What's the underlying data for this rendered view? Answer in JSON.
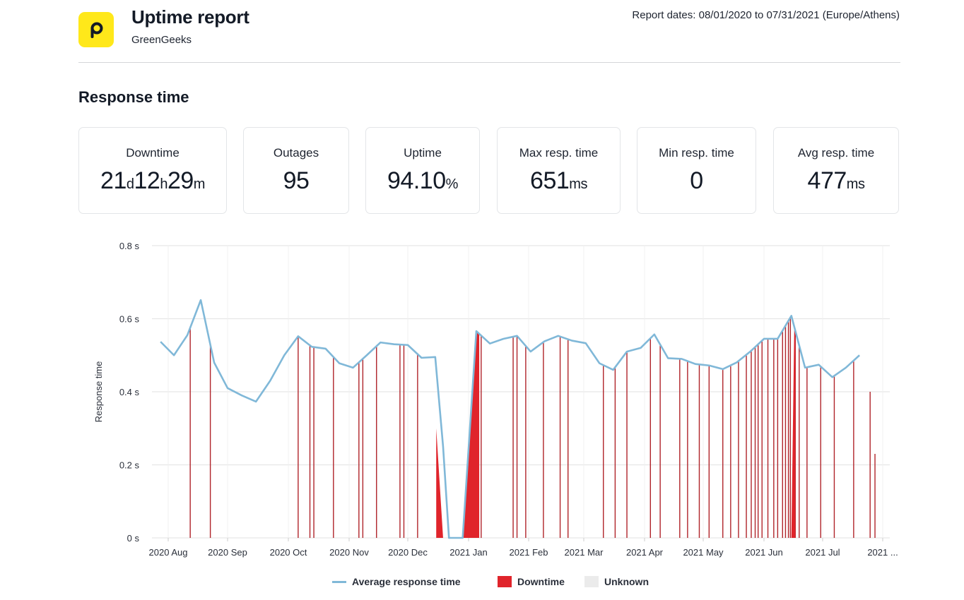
{
  "header": {
    "logo_letter": "p",
    "title": "Uptime report",
    "subtitle": "GreenGeeks",
    "report_dates": "Report dates: 08/01/2020 to 07/31/2021 (Europe/Athens)"
  },
  "section_title": "Response time",
  "stats": [
    {
      "label": "Downtime",
      "value_parts": [
        [
          "21",
          "d"
        ],
        [
          "12",
          "h"
        ],
        [
          "29",
          "m"
        ]
      ]
    },
    {
      "label": "Outages",
      "value_parts": [
        [
          "95",
          ""
        ]
      ]
    },
    {
      "label": "Uptime",
      "value_parts": [
        [
          "94.10",
          "%"
        ]
      ]
    },
    {
      "label": "Max resp. time",
      "value_parts": [
        [
          "651",
          "ms"
        ]
      ]
    },
    {
      "label": "Min resp. time",
      "value_parts": [
        [
          "0",
          ""
        ]
      ]
    },
    {
      "label": "Avg resp. time",
      "value_parts": [
        [
          "477",
          "ms"
        ]
      ]
    }
  ],
  "colors": {
    "accent_logo": "#ffe81a",
    "line": "#80b8d8",
    "downtime": "#e0242b",
    "unknown": "#ebebeb",
    "grid": "#e6e6e6"
  },
  "chart_data": {
    "type": "line",
    "title": "",
    "xlabel": "",
    "ylabel": "Response time",
    "ylim": [
      0,
      0.8
    ],
    "yticks": [
      0,
      0.2,
      0.4,
      0.6,
      0.8
    ],
    "ytick_labels": [
      "0 s",
      "0.2 s",
      "0.4 s",
      "0.6 s",
      "0.8 s"
    ],
    "x_unit": "days since 2020-08-01",
    "xlim": [
      -5,
      371
    ],
    "xticks": [
      0,
      31,
      61,
      92,
      122,
      153,
      184,
      212,
      243,
      273,
      304,
      334,
      365
    ],
    "xtick_labels": [
      "2020 Aug",
      "2020 Sep",
      "2020 Oct",
      "2020 Nov",
      "2020 Dec",
      "2021 Jan",
      "2021 Feb",
      "2021 Mar",
      "2021 Apr",
      "2021 May",
      "2021 Jun",
      "2021 Jul",
      "2021 ..."
    ],
    "grid": true,
    "legend": {
      "position": "bottom-center",
      "entries": [
        "Average response time",
        "Downtime",
        "Unknown"
      ]
    },
    "series": [
      {
        "name": "Average response time",
        "x": [
          -4,
          3,
          10,
          17,
          24,
          31,
          38,
          45,
          52,
          59,
          66,
          73,
          80,
          87,
          94,
          101,
          108,
          115,
          122,
          129,
          136,
          140,
          143,
          150,
          157,
          164,
          171,
          178,
          185,
          192,
          199,
          206,
          213,
          220,
          227,
          234,
          241,
          248,
          255,
          262,
          269,
          276,
          283,
          290,
          297,
          304,
          311,
          318,
          325,
          332,
          339,
          346,
          353
        ],
        "y": [
          0.537,
          0.5,
          0.555,
          0.651,
          0.48,
          0.41,
          0.39,
          0.373,
          0.43,
          0.5,
          0.552,
          0.523,
          0.518,
          0.478,
          0.466,
          0.5,
          0.535,
          0.53,
          0.528,
          0.493,
          0.495,
          0.25,
          0.0,
          0.0,
          0.566,
          0.532,
          0.545,
          0.553,
          0.51,
          0.538,
          0.553,
          0.54,
          0.533,
          0.478,
          0.46,
          0.51,
          0.52,
          0.557,
          0.492,
          0.49,
          0.476,
          0.472,
          0.462,
          0.48,
          0.51,
          0.545,
          0.545,
          0.608,
          0.466,
          0.474,
          0.44,
          0.466,
          0.5
        ]
      }
    ],
    "downtime_spikes_x": [
      11.5,
      22,
      66,
      72,
      74,
      84,
      97,
      99,
      106,
      118,
      120,
      127,
      157.5,
      159.5,
      176,
      178,
      182.5,
      191.5,
      200,
      204,
      222,
      228,
      234,
      246,
      251,
      261,
      265,
      271,
      276,
      283,
      287,
      291,
      295,
      297.5,
      299.5,
      301,
      303,
      306,
      309,
      311,
      313.5,
      315,
      316.5,
      317.5,
      320,
      322,
      326,
      333,
      340,
      350,
      358.5,
      361
    ],
    "downtime_spike_heights": {
      "358.5": 0.4,
      "361": 0.23
    },
    "downtime_areas": [
      {
        "name": "December outage",
        "x": [
          136.5,
          140,
          143
        ],
        "y": [
          0.3,
          0.0,
          0.0
        ]
      },
      {
        "name": "January outage",
        "x": [
          150,
          157,
          158.5
        ],
        "y": [
          0.0,
          0.566,
          0.56
        ]
      },
      {
        "name": "June outage",
        "x": [
          318,
          319.5,
          320
        ],
        "y": [
          0.0,
          0.58,
          0.55
        ]
      }
    ]
  }
}
